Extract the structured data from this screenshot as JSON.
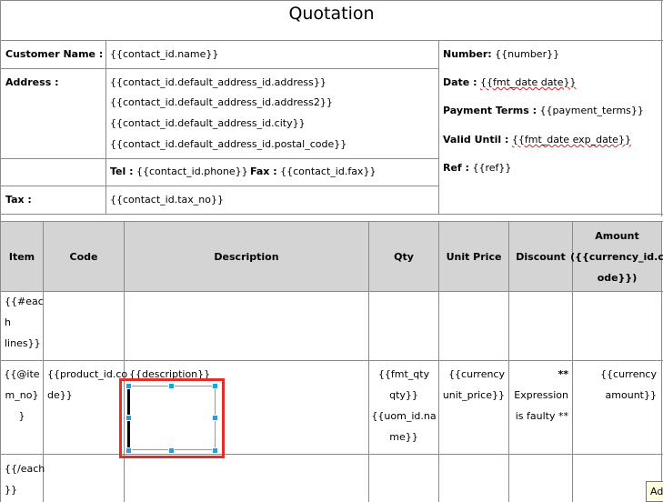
{
  "page": {
    "title": "Quotation"
  },
  "header": {
    "customer_label": "Customer Name :",
    "customer_value": "{{contact_id.name}}",
    "address_label": "Address :",
    "address_lines": [
      "{{contact_id.default_address_id.address}}",
      "{{contact_id.default_address_id.address2}}",
      "{{contact_id.default_address_id.city}}",
      "{{contact_id.default_address_id.postal_code}}"
    ],
    "tel_label": "Tel :",
    "tel_value": "{{contact_id.phone}}",
    "fax_label": "Fax :",
    "fax_value": "{{contact_id.fax}}",
    "tax_label": "Tax :",
    "tax_value": "{{contact_id.tax_no}}",
    "number_label": "Number:",
    "number_value": "{{number}}",
    "date_label": "Date :",
    "date_value": "{{fmt_date date}}",
    "terms_label": "Payment Terms :",
    "terms_value": "{{payment_terms}}",
    "valid_label": "Valid Until :",
    "valid_value": "{{fmt_date exp_date}}",
    "ref_label": "Ref :",
    "ref_value": "{{ref}}"
  },
  "table": {
    "columns": [
      "Item",
      "Code",
      "Description",
      "Qty",
      "Unit Price",
      "Discount",
      "Amount ({{currency_id.code}})"
    ],
    "amount_lines": [
      "Amount",
      "({{currency_id.c",
      "ode}})"
    ],
    "each_lines": [
      "{{#eac",
      "h",
      "lines}}"
    ],
    "row": {
      "item": [
        "{{@ite",
        "m_no}",
        "}"
      ],
      "code": [
        "{{product_id.co",
        "de}}"
      ],
      "description": "{{description}}",
      "qty": [
        "{{fmt_qty",
        "qty}}",
        "{{uom_id.na",
        "me}}"
      ],
      "unit_price": [
        "{{currency",
        "unit_price}}"
      ],
      "discount": [
        "**",
        "Expression",
        "is faulty **"
      ],
      "amount": [
        "{{currency",
        "amount}}"
      ]
    },
    "end_each": [
      "{{/each",
      "}}"
    ]
  },
  "tooltip": {
    "text": "Ad"
  },
  "colors": {
    "header_bg": "#d4d4d4",
    "grid": "#8a8a8a",
    "selection": "#1ea1e3",
    "highlight": "#e52c25"
  }
}
